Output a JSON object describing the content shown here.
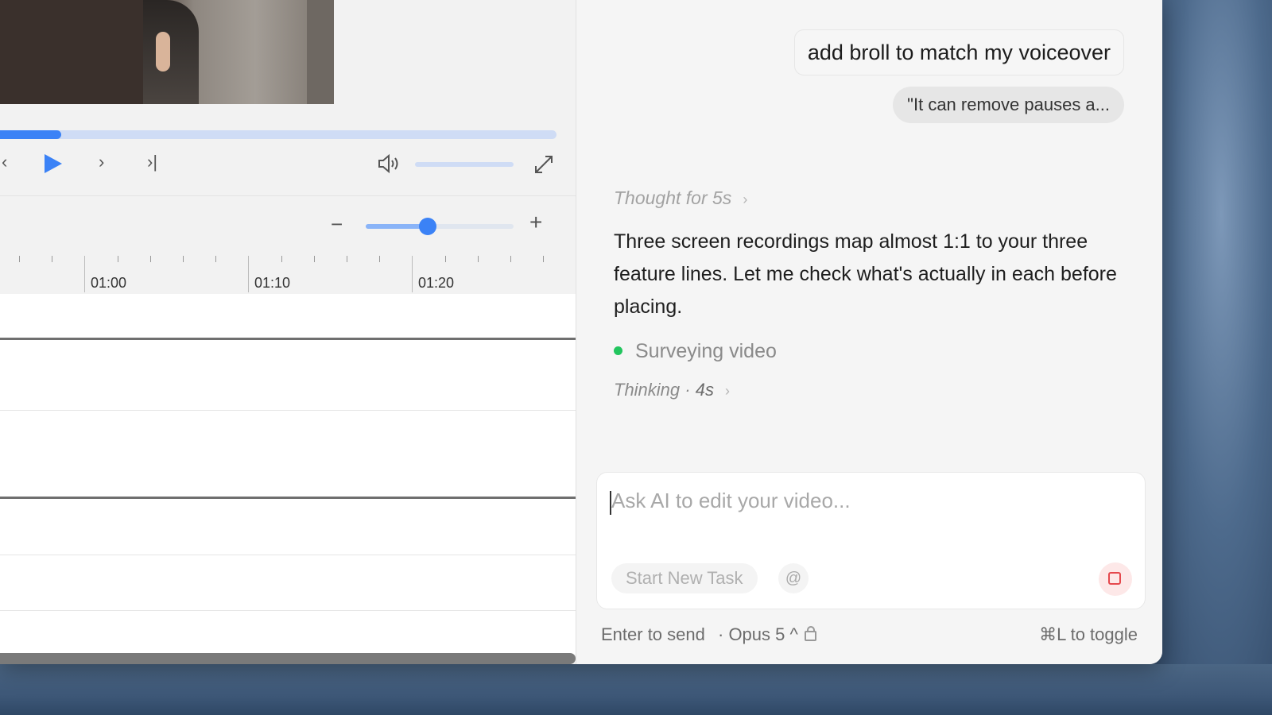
{
  "player": {
    "progress": 0.11,
    "controls": {
      "prev_frame": "‹",
      "next_frame": "›",
      "skip_end": "›|",
      "volume_icon": "speaker-icon",
      "fullscreen_icon": "expand-icon"
    }
  },
  "timeline": {
    "zoom_minus": "−",
    "zoom_plus": "+",
    "zoom_level": 0.42,
    "ruler_labels": [
      "01:00",
      "01:10",
      "01:20"
    ]
  },
  "chat": {
    "user_message": "add broll to match my voiceover",
    "quote_chip": "\"It can remove pauses a...",
    "thought_label": "Thought for 5s",
    "assistant_message": "Three screen recordings map almost 1:1 to your three feature lines. Let me check what's actually in each before placing.",
    "status_text": "Surveying video",
    "thinking_label": "Thinking",
    "thinking_separator": " · ",
    "thinking_duration": "4s",
    "input_placeholder": "Ask AI to edit your video...",
    "start_new_task": "Start New Task",
    "mention_symbol": "@",
    "footer_send": "Enter to send",
    "footer_model": "· Opus 5 ^",
    "footer_toggle": "⌘L to toggle"
  },
  "colors": {
    "accent": "#3b82f6",
    "status_green": "#22c55e",
    "stop_red": "#e5484d"
  }
}
